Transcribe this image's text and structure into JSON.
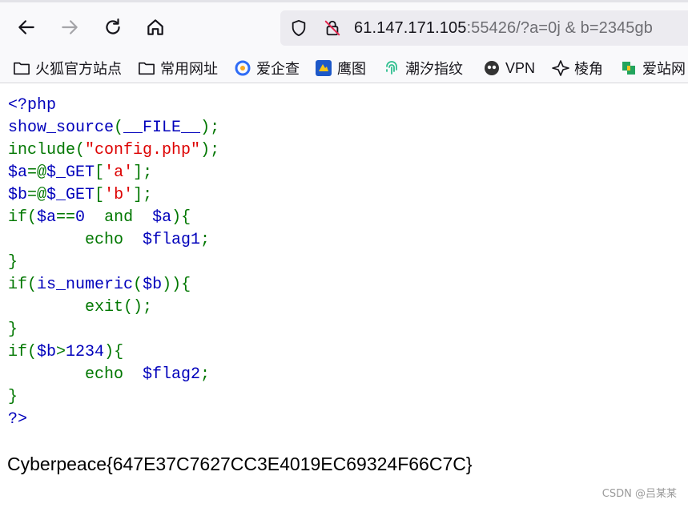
{
  "toolbar": {
    "back_icon": "arrow-left-icon",
    "forward_icon": "arrow-right-icon",
    "reload_icon": "reload-icon",
    "home_icon": "home-icon"
  },
  "urlbar": {
    "host": "61.147.171.105",
    "rest": ":55426/?a=0j & b=2345gb",
    "shield_icon": "shield-icon",
    "insecure_icon": "insecure-lock-icon"
  },
  "bookmarks": [
    {
      "label": "火狐官方站点",
      "icon": "folder-icon"
    },
    {
      "label": "常用网址",
      "icon": "folder-icon"
    },
    {
      "label": "爱企查",
      "icon": "aiqicha-icon"
    },
    {
      "label": "鹰图",
      "icon": "hunter-icon"
    },
    {
      "label": "潮汐指纹",
      "icon": "fingerprint-icon"
    },
    {
      "label": "VPN",
      "icon": "vpn-icon"
    },
    {
      "label": "棱角",
      "icon": "lengjiao-icon"
    },
    {
      "label": "爱站网",
      "icon": "aizhan-icon"
    }
  ],
  "code": {
    "l1": "<?php",
    "l2a": "show_source",
    "l2b": "(",
    "l2c": "__FILE__",
    "l2d": ");",
    "l3a": "include",
    "l3b": "(",
    "l3c": "\"config.php\"",
    "l3d": ");",
    "l4a": "$a",
    "l4b": "=@",
    "l4c": "$_GET",
    "l4d": "[",
    "l4e": "'a'",
    "l4f": "];",
    "l5a": "$b",
    "l5b": "=@",
    "l5c": "$_GET",
    "l5d": "[",
    "l5e": "'b'",
    "l5f": "];",
    "l6a": "if(",
    "l6b": "$a",
    "l6c": "==",
    "l6d": "0  ",
    "l6e": "and  ",
    "l6f": "$a",
    "l6g": "){",
    "l7a": "        echo  ",
    "l7b": "$flag1",
    "l7c": ";",
    "l8": "}",
    "l9a": "if(",
    "l9b": "is_numeric",
    "l9c": "(",
    "l9d": "$b",
    "l9e": ")){",
    "l10a": "        exit",
    "l10b": "();",
    "l11": "}",
    "l12a": "if(",
    "l12b": "$b",
    "l12c": ">",
    "l12d": "1234",
    "l12e": "){",
    "l13a": "        echo  ",
    "l13b": "$flag2",
    "l13c": ";",
    "l14": "}",
    "l15": "?>"
  },
  "flag_output": "Cyberpeace{647E37C7627CC3E4019EC69324F66C7C}",
  "watermark": "CSDN @吕某某"
}
